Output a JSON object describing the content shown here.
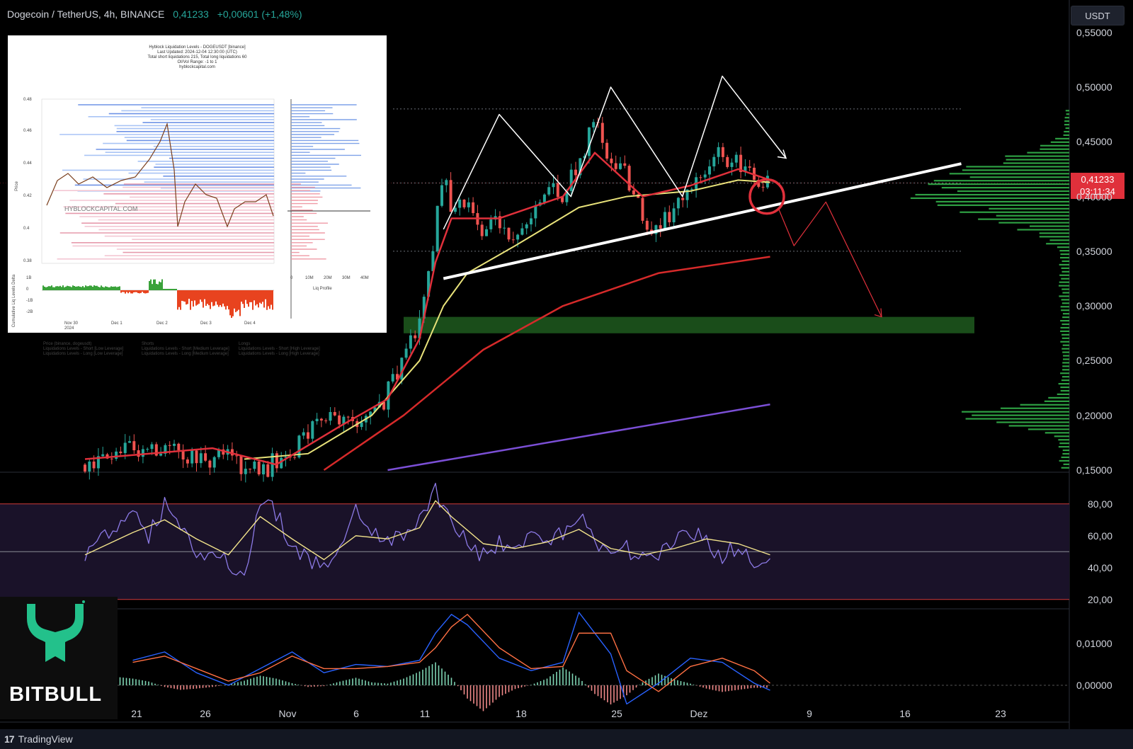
{
  "header": {
    "symbol": "Dogecoin / TetherUS, 4h, BINANCE",
    "price": "0,41233",
    "change": "+0,00601 (+1,48%)"
  },
  "currency_button": "USDT",
  "price_tag": {
    "price": "0,41233",
    "countdown": "03:11:34"
  },
  "branding": {
    "logo_text": "BITBULL",
    "platform": "TradingView"
  },
  "colors": {
    "up": "#26a69a",
    "down": "#ef5350",
    "ema_fast": "#e0303b",
    "ema_slow": "#e8e27a",
    "ma_200": "#d62a2a",
    "ma_long": "#7b4fd6",
    "volume_profile": "#2ea043",
    "zone": "#1f5a1f",
    "rsi": "#8c7ae6",
    "rsi_ma": "#f2e38b",
    "macd": "#2962ff",
    "signal": "#ff7043"
  },
  "inset": {
    "title": "Hyblock Liquidation Levels - DOGEUSDT [binance]",
    "subtitle_1": "Last Updated: 2024-12-04 12:30:00 (UTC)",
    "subtitle_2": "Total short liquidations 215, Total long liquidations 60",
    "subtitle_3": "OI/Vol Range: -1 to 1",
    "subtitle_4": "hyblockcapital.com",
    "watermark": "HYBLOCKCAPITAL.COM",
    "price_axis_label": "Price",
    "delta_axis_label": "Cumulative Liq Levels Delta",
    "profile_label": "Liq Profile",
    "price_ticks": [
      "0.48",
      "0.46",
      "0.44",
      "0.42",
      "0.4",
      "0.38"
    ],
    "delta_ticks": [
      "1B",
      "0",
      "-1B",
      "-2B"
    ],
    "profile_ticks": [
      "0",
      "10M",
      "20M",
      "30M",
      "40M"
    ],
    "date_ticks": [
      "Nov 30\n2024",
      "Dec 1",
      "Dec 2",
      "Dec 3",
      "Dec 4"
    ],
    "legend": [
      "Price (binance, dogeusdt)",
      "Shorts",
      "Longs",
      "Liquidations Levels - Short [Low Leverage]",
      "Liquidations Levels - Short [Medium Leverage]",
      "Liquidations Levels - Short [High Leverage]",
      "Liquidations Levels - Long [Low Leverage]",
      "Liquidations Levels - Long [Medium Leverage]",
      "Liquidations Levels - Long [High Leverage]"
    ]
  },
  "chart_data": [
    {
      "type": "line",
      "name": "price",
      "title": "Dogecoin / TetherUS, 4h, BINANCE",
      "x_ticks": [
        "21",
        "26",
        "Nov",
        "6",
        "11",
        "18",
        "25",
        "Dez",
        "9",
        "16",
        "23"
      ],
      "y_ticks": [
        "0,55000",
        "0,50000",
        "0,45000",
        "0,40000",
        "0,35000",
        "0,30000",
        "0,25000",
        "0,20000",
        "0,15000"
      ],
      "ylim": [
        0.15,
        0.555
      ],
      "price_path": [
        [
          0,
          0.155
        ],
        [
          4,
          0.175
        ],
        [
          6,
          0.165
        ],
        [
          9,
          0.16
        ],
        [
          11,
          0.15
        ],
        [
          13,
          0.165
        ],
        [
          15,
          0.2
        ],
        [
          16,
          0.19
        ],
        [
          18,
          0.2
        ],
        [
          19,
          0.22
        ],
        [
          20,
          0.25
        ],
        [
          21,
          0.28
        ],
        [
          21.5,
          0.33
        ],
        [
          22,
          0.37
        ],
        [
          22.5,
          0.42
        ],
        [
          23,
          0.39
        ],
        [
          24,
          0.4
        ],
        [
          25,
          0.37
        ],
        [
          26,
          0.38
        ],
        [
          27,
          0.36
        ],
        [
          28,
          0.39
        ],
        [
          29,
          0.41
        ],
        [
          30,
          0.4
        ],
        [
          31,
          0.43
        ],
        [
          32,
          0.47
        ],
        [
          33,
          0.43
        ],
        [
          34,
          0.42
        ],
        [
          35,
          0.38
        ],
        [
          36,
          0.37
        ],
        [
          37,
          0.39
        ],
        [
          38,
          0.41
        ],
        [
          39,
          0.42
        ],
        [
          40,
          0.44
        ],
        [
          41,
          0.43
        ],
        [
          42,
          0.42
        ],
        [
          43,
          0.41233
        ]
      ],
      "ema_fast": [
        [
          0,
          0.16
        ],
        [
          8,
          0.17
        ],
        [
          12,
          0.155
        ],
        [
          16,
          0.19
        ],
        [
          19,
          0.215
        ],
        [
          21,
          0.27
        ],
        [
          22,
          0.34
        ],
        [
          23,
          0.38
        ],
        [
          26,
          0.38
        ],
        [
          30,
          0.4
        ],
        [
          32,
          0.44
        ],
        [
          35,
          0.4
        ],
        [
          38,
          0.41
        ],
        [
          41,
          0.425
        ],
        [
          43,
          0.415
        ]
      ],
      "ema_slow": [
        [
          10,
          0.16
        ],
        [
          14,
          0.165
        ],
        [
          18,
          0.2
        ],
        [
          21,
          0.25
        ],
        [
          22.5,
          0.3
        ],
        [
          24,
          0.33
        ],
        [
          27,
          0.355
        ],
        [
          31,
          0.39
        ],
        [
          34,
          0.4
        ],
        [
          38,
          0.405
        ],
        [
          41,
          0.415
        ],
        [
          43,
          0.413
        ]
      ],
      "ma_200": [
        [
          15,
          0.15
        ],
        [
          20,
          0.2
        ],
        [
          25,
          0.26
        ],
        [
          30,
          0.3
        ],
        [
          36,
          0.33
        ],
        [
          43,
          0.345
        ]
      ],
      "ma_long": [
        [
          19,
          0.15
        ],
        [
          43,
          0.21
        ]
      ],
      "trendline": [
        [
          22.5,
          0.325
        ],
        [
          55,
          0.43
        ]
      ],
      "pattern_peaks": [
        [
          22.5,
          0.37
        ],
        [
          26,
          0.475
        ],
        [
          30.5,
          0.4
        ],
        [
          33,
          0.5
        ],
        [
          37.5,
          0.4
        ],
        [
          40,
          0.51
        ],
        [
          44,
          0.435
        ]
      ],
      "projection": [
        [
          43.5,
          0.39
        ],
        [
          44.5,
          0.355
        ],
        [
          46.5,
          0.395
        ],
        [
          50,
          0.29
        ]
      ],
      "support_zone": [
        0.275,
        0.29
      ],
      "last_price": 0.41233
    },
    {
      "type": "line",
      "name": "RSI",
      "y_ticks": [
        "80,00",
        "60,00",
        "40,00",
        "20,00"
      ],
      "ylim": [
        15,
        95
      ],
      "levels": [
        80,
        50,
        20
      ],
      "rsi": [
        [
          0,
          48
        ],
        [
          2,
          65
        ],
        [
          3,
          72
        ],
        [
          4,
          60
        ],
        [
          5,
          80
        ],
        [
          6,
          65
        ],
        [
          7,
          48
        ],
        [
          8,
          52
        ],
        [
          9,
          42
        ],
        [
          10,
          38
        ],
        [
          11,
          82
        ],
        [
          12,
          75
        ],
        [
          13,
          55
        ],
        [
          14,
          45
        ],
        [
          15,
          40
        ],
        [
          16,
          55
        ],
        [
          17,
          78
        ],
        [
          18,
          62
        ],
        [
          19,
          55
        ],
        [
          20,
          60
        ],
        [
          21,
          70
        ],
        [
          22,
          88
        ],
        [
          23,
          65
        ],
        [
          24,
          55
        ],
        [
          25,
          48
        ],
        [
          26,
          55
        ],
        [
          27,
          50
        ],
        [
          28,
          62
        ],
        [
          29,
          58
        ],
        [
          30,
          60
        ],
        [
          31,
          75
        ],
        [
          32,
          55
        ],
        [
          33,
          48
        ],
        [
          34,
          52
        ],
        [
          35,
          45
        ],
        [
          36,
          50
        ],
        [
          37,
          55
        ],
        [
          38,
          65
        ],
        [
          39,
          55
        ],
        [
          40,
          48
        ],
        [
          41,
          52
        ],
        [
          42,
          45
        ],
        [
          43,
          48
        ]
      ],
      "rsi_ma": [
        [
          0,
          48
        ],
        [
          3,
          62
        ],
        [
          5,
          70
        ],
        [
          7,
          58
        ],
        [
          9,
          48
        ],
        [
          11,
          72
        ],
        [
          13,
          58
        ],
        [
          15,
          45
        ],
        [
          17,
          60
        ],
        [
          19,
          58
        ],
        [
          21,
          65
        ],
        [
          22,
          82
        ],
        [
          23,
          72
        ],
        [
          25,
          55
        ],
        [
          27,
          52
        ],
        [
          29,
          56
        ],
        [
          31,
          64
        ],
        [
          33,
          52
        ],
        [
          35,
          48
        ],
        [
          37,
          52
        ],
        [
          39,
          58
        ],
        [
          41,
          55
        ],
        [
          43,
          48
        ]
      ]
    },
    {
      "type": "bar",
      "name": "MACD",
      "y_ticks": [
        "0,01000",
        "0,00000"
      ],
      "ylim": [
        -0.0085,
        0.018
      ],
      "histogram": [
        0.0003,
        0.0012,
        0.002,
        0.0016,
        0.0009,
        -0.0004,
        -0.0011,
        -0.0008,
        -0.0004,
        0.0002,
        0.0011,
        0.0023,
        0.0016,
        0.0005,
        -0.0004,
        -0.0002,
        0.0009,
        0.0018,
        0.0007,
        0.0004,
        0.0016,
        0.0033,
        0.0055,
        0.0018,
        -0.0032,
        -0.0062,
        -0.0028,
        -0.0009,
        0.0001,
        0.0016,
        0.0043,
        0.0018,
        -0.0021,
        -0.0046,
        -0.0024,
        0.0007,
        0.0028,
        0.0014,
        0.0004,
        -0.0008,
        -0.0016,
        -0.0011,
        -0.0006
      ],
      "macd": [
        [
          3,
          0.006
        ],
        [
          5,
          0.008
        ],
        [
          7,
          0.003
        ],
        [
          9,
          0.0
        ],
        [
          11,
          0.004
        ],
        [
          13,
          0.008
        ],
        [
          15,
          0.003
        ],
        [
          17,
          0.005
        ],
        [
          19,
          0.0045
        ],
        [
          21,
          0.006
        ],
        [
          22,
          0.0125
        ],
        [
          23,
          0.017
        ],
        [
          24,
          0.0145
        ],
        [
          26,
          0.0065
        ],
        [
          28,
          0.0035
        ],
        [
          30,
          0.0055
        ],
        [
          31,
          0.0175
        ],
        [
          33,
          0.0075
        ],
        [
          34,
          -0.0045
        ],
        [
          36,
          0.0005
        ],
        [
          38,
          0.0065
        ],
        [
          40,
          0.0055
        ],
        [
          42,
          0.0005
        ],
        [
          43,
          -0.0012
        ]
      ],
      "signal": [
        [
          3,
          0.0055
        ],
        [
          5,
          0.007
        ],
        [
          7,
          0.004
        ],
        [
          9,
          0.001
        ],
        [
          11,
          0.003
        ],
        [
          13,
          0.007
        ],
        [
          15,
          0.004
        ],
        [
          17,
          0.004
        ],
        [
          19,
          0.0045
        ],
        [
          21,
          0.0055
        ],
        [
          22,
          0.009
        ],
        [
          23,
          0.014
        ],
        [
          24,
          0.017
        ],
        [
          26,
          0.009
        ],
        [
          28,
          0.004
        ],
        [
          30,
          0.0045
        ],
        [
          31,
          0.0125
        ],
        [
          33,
          0.0125
        ],
        [
          34,
          0.0035
        ],
        [
          36,
          -0.0015
        ],
        [
          38,
          0.0045
        ],
        [
          40,
          0.0065
        ],
        [
          42,
          0.0035
        ],
        [
          43,
          0.0005
        ]
      ]
    }
  ]
}
